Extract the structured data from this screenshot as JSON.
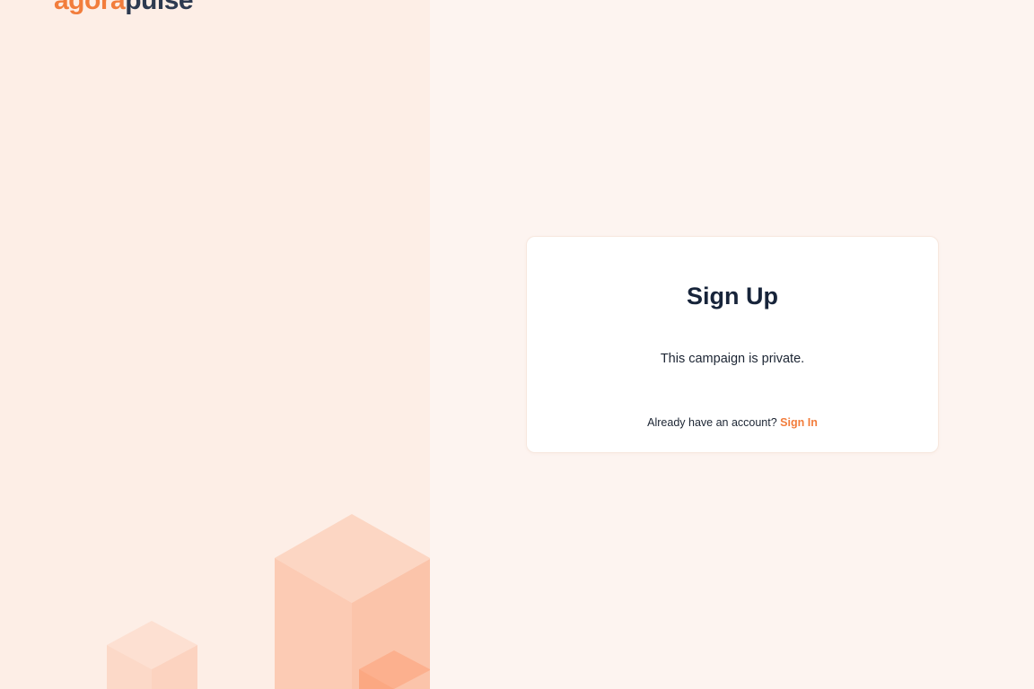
{
  "brand": {
    "logo_part1": "agora",
    "logo_part2": "pulse",
    "accent_color": "#f27d3c",
    "dark_color": "#2d3a50"
  },
  "signup_card": {
    "title": "Sign Up",
    "message": "This campaign is private.",
    "account_prompt": "Already have an account?",
    "sign_in_label": "Sign In"
  },
  "colors": {
    "left_panel_bg": "#fdeee6",
    "right_panel_bg": "#fdf4f0",
    "card_bg": "#ffffff",
    "heading_color": "#17243a"
  }
}
